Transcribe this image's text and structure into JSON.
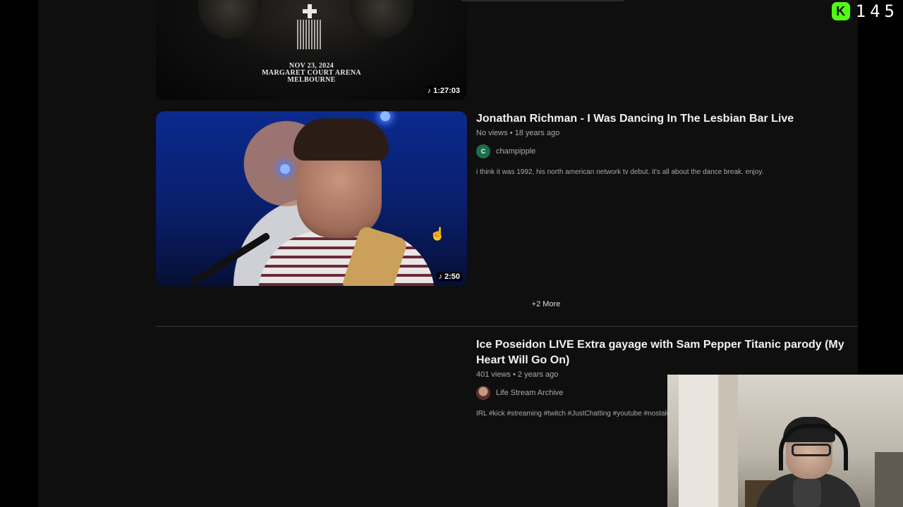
{
  "overlay": {
    "kick_logo": "K",
    "viewer_count": "145"
  },
  "poster": {
    "line1": "NOV 23, 2024",
    "line2": "MARGARET COURT ARENA",
    "line3": "MELBOURNE"
  },
  "videos": [
    {
      "duration": "1:27:03"
    },
    {
      "title": "Jonathan Richman - I Was Dancing In The Lesbian Bar Live",
      "views": "No views",
      "age": "18 years ago",
      "stats_sep": "•",
      "channel": "champipple",
      "channel_initial": "C",
      "description": "i think it was 1992, his north american network tv debut. it's all about the dance break. enjoy.",
      "duration": "2:50"
    },
    {
      "title": "Ice Poseidon LIVE Extra gayage with Sam Pepper Titanic parody (My Heart Will Go On)",
      "views": "401 views",
      "age": "2 years ago",
      "stats_sep": "•",
      "channel": "Life Stream Archive",
      "description": "IRL #kick #streaming #twitch #JustChatting #youtube #nostalgia"
    }
  ],
  "more_label": "+2 More",
  "icons": {
    "music_note": "♪",
    "cursor": "☝"
  },
  "colors": {
    "background": "#0f0f0f",
    "kick_green": "#53fc18",
    "channel_avatar": "#1b6e4a"
  }
}
